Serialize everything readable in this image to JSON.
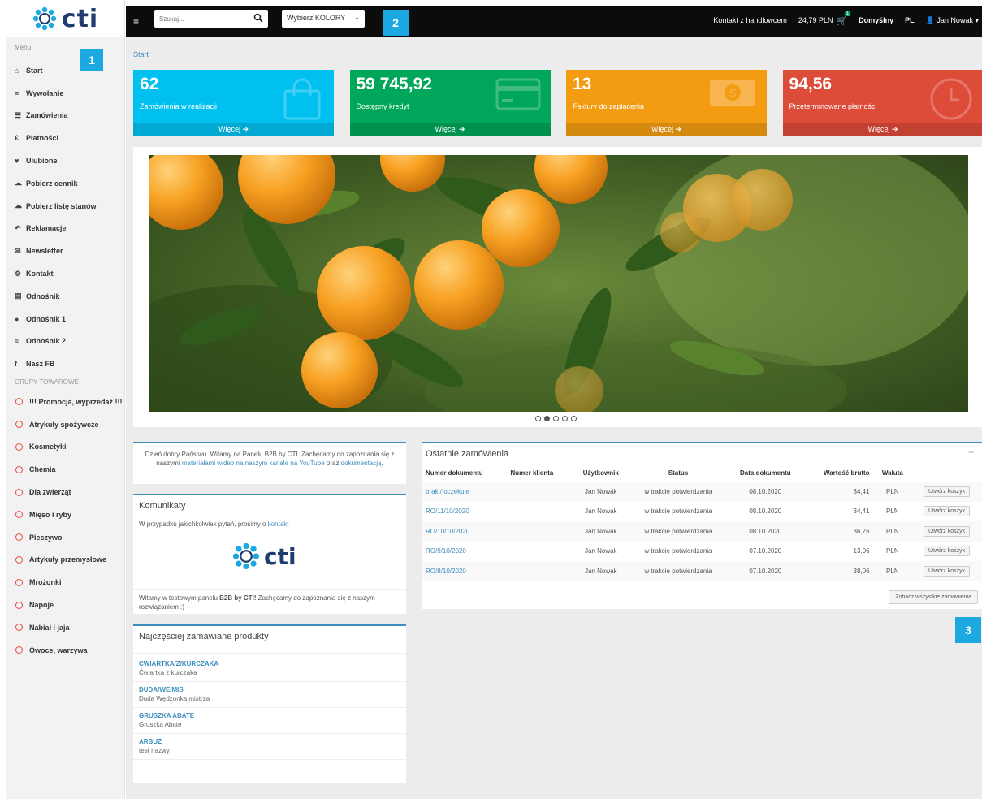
{
  "sidebar": {
    "logo": "cti",
    "menu_title": "Menu",
    "badge": "1",
    "items": [
      {
        "icon": "home-icon",
        "glyph": "⌂",
        "label": "Start"
      },
      {
        "icon": "list-icon",
        "glyph": "≡",
        "label": "Wywołanie"
      },
      {
        "icon": "list-icon",
        "glyph": "☰",
        "label": "Zamówienia"
      },
      {
        "icon": "euro-icon",
        "glyph": "€",
        "label": "Płatności"
      },
      {
        "icon": "heart-icon",
        "glyph": "♥",
        "label": "Ulubione"
      },
      {
        "icon": "cloud-download-icon",
        "glyph": "☁",
        "label": "Pobierz cennik"
      },
      {
        "icon": "cloud-download-icon",
        "glyph": "☁",
        "label": "Pobierz listę stanów"
      },
      {
        "icon": "reply-icon",
        "glyph": "↶",
        "label": "Reklamacje"
      },
      {
        "icon": "envelope-icon",
        "glyph": "✉",
        "label": "Newsletter"
      },
      {
        "icon": "gears-icon",
        "glyph": "⚙",
        "label": "Kontakt"
      },
      {
        "icon": "file-icon",
        "glyph": "▤",
        "label": "Odnośnik"
      },
      {
        "icon": "circle-icon",
        "glyph": "●",
        "label": "Odnośnik 1"
      },
      {
        "icon": "chevrons-up-icon",
        "glyph": "≈",
        "label": "Odnośnik 2"
      },
      {
        "icon": "facebook-icon",
        "glyph": "f",
        "label": "Nasz FB"
      }
    ],
    "groups_title": "GRUPY TOWAROWE",
    "groups": [
      "!!! Promocja, wyprzedaż !!!",
      "Atrykuły spożywcze",
      "Kosmetyki",
      "Chemia",
      "Dla zwierząt",
      "Mięso i ryby",
      "Pieczywo",
      "Artykuły przemysłowe",
      "Mrożonki",
      "Napoje",
      "Nabiał i jaja",
      "Owoce, warzywa"
    ]
  },
  "topbar": {
    "search_placeholder": "Szukaj...",
    "color_select": "Wybierz KOLORY",
    "badge": "2",
    "contact": "Kontakt z handlowcem",
    "cart_total": "24,79 PLN",
    "cart_count": "1",
    "default_label": "Domyślny",
    "language": "PL",
    "user": "Jan Nowak"
  },
  "breadcrumb": "Start",
  "stats": [
    {
      "value": "62",
      "label": "Zamówienia w realizacji",
      "more": "Więcej",
      "color": "#00c0ef",
      "icon": "shopping-bag-icon"
    },
    {
      "value": "59 745,92",
      "label": "Dostępny kredyt",
      "more": "Więcej",
      "color": "#00a65a",
      "icon": "credit-card-icon"
    },
    {
      "value": "13",
      "label": "Faktury do zapłacenia",
      "more": "Więcej",
      "color": "#f39c12",
      "icon": "money-icon"
    },
    {
      "value": "94,56",
      "label": "Przeterminowane płatności",
      "more": "Więcej",
      "color": "#dd4b39",
      "icon": "clock-icon"
    }
  ],
  "slider": {
    "active_dot": 1,
    "dot_count": 5
  },
  "welcome": {
    "text1": "Dzień dobry Państwu. Witamy na Panelu B2B by CTI. Zachęcamy do zapoznania się z naszymi ",
    "link1": "materiałami wideo na naszym kanale na YouTube",
    "text2": " oraz ",
    "link2": "dokumentacją",
    "text3": "."
  },
  "komunikaty": {
    "title": "Komunikaty",
    "text": "W przypadku jakichkolwiek pytań, prosimy o ",
    "link": "kontakt",
    "logo": "cti",
    "bottom_pre": "Witamy w testowym panelu ",
    "bottom_bold": "B2B by CTI!",
    "bottom_post": " Zachęcamy do zapoznania się z naszym rozwiązaniem :)"
  },
  "najczesciej": {
    "title": "Najczęściej zamawiane produkty",
    "products": [
      {
        "code": "CWIARTKA/Z/KURCZAKA",
        "name": "Ćwiartka z kurczaka"
      },
      {
        "code": "DUDA/WE/MIS",
        "name": "Duda Wędzonka mistrza"
      },
      {
        "code": "GRUSZKA ABATE",
        "name": "Gruszka Abate"
      },
      {
        "code": "ARBUZ",
        "name": "test nazwy"
      }
    ]
  },
  "orders": {
    "title": "Ostatnie zamówienia",
    "collapse": "−",
    "headers": [
      "Numer dokumentu",
      "Numer klienta",
      "Użytkownik",
      "Status",
      "Data dokumentu",
      "Wartość brutto",
      "Waluta",
      ""
    ],
    "rows": [
      {
        "doc": "brak / oczekuje",
        "client": "",
        "user": "Jan Nowak",
        "status": "w trakcie potwierdzania",
        "date": "08.10.2020",
        "value": "34,41",
        "currency": "PLN",
        "action": "Utwórz koszyk"
      },
      {
        "doc": "RO/11/10/2020",
        "client": "",
        "user": "Jan Nowak",
        "status": "w trakcie potwierdzania",
        "date": "08.10.2020",
        "value": "34,41",
        "currency": "PLN",
        "action": "Utwórz koszyk"
      },
      {
        "doc": "RO/10/10/2020",
        "client": "",
        "user": "Jan Nowak",
        "status": "w trakcie potwierdzania",
        "date": "08.10.2020",
        "value": "36,76",
        "currency": "PLN",
        "action": "Utwórz koszyk"
      },
      {
        "doc": "RO/9/10/2020",
        "client": "",
        "user": "Jan Nowak",
        "status": "w trakcie potwierdzania",
        "date": "07.10.2020",
        "value": "13,06",
        "currency": "PLN",
        "action": "Utwórz koszyk"
      },
      {
        "doc": "RO/8/10/2020",
        "client": "",
        "user": "Jan Nowak",
        "status": "w trakcie potwierdzania",
        "date": "07.10.2020",
        "value": "38,06",
        "currency": "PLN",
        "action": "Utwórz koszyk"
      }
    ],
    "see_all": "Zobacz wszystkie zamówienia",
    "badge": "3"
  }
}
